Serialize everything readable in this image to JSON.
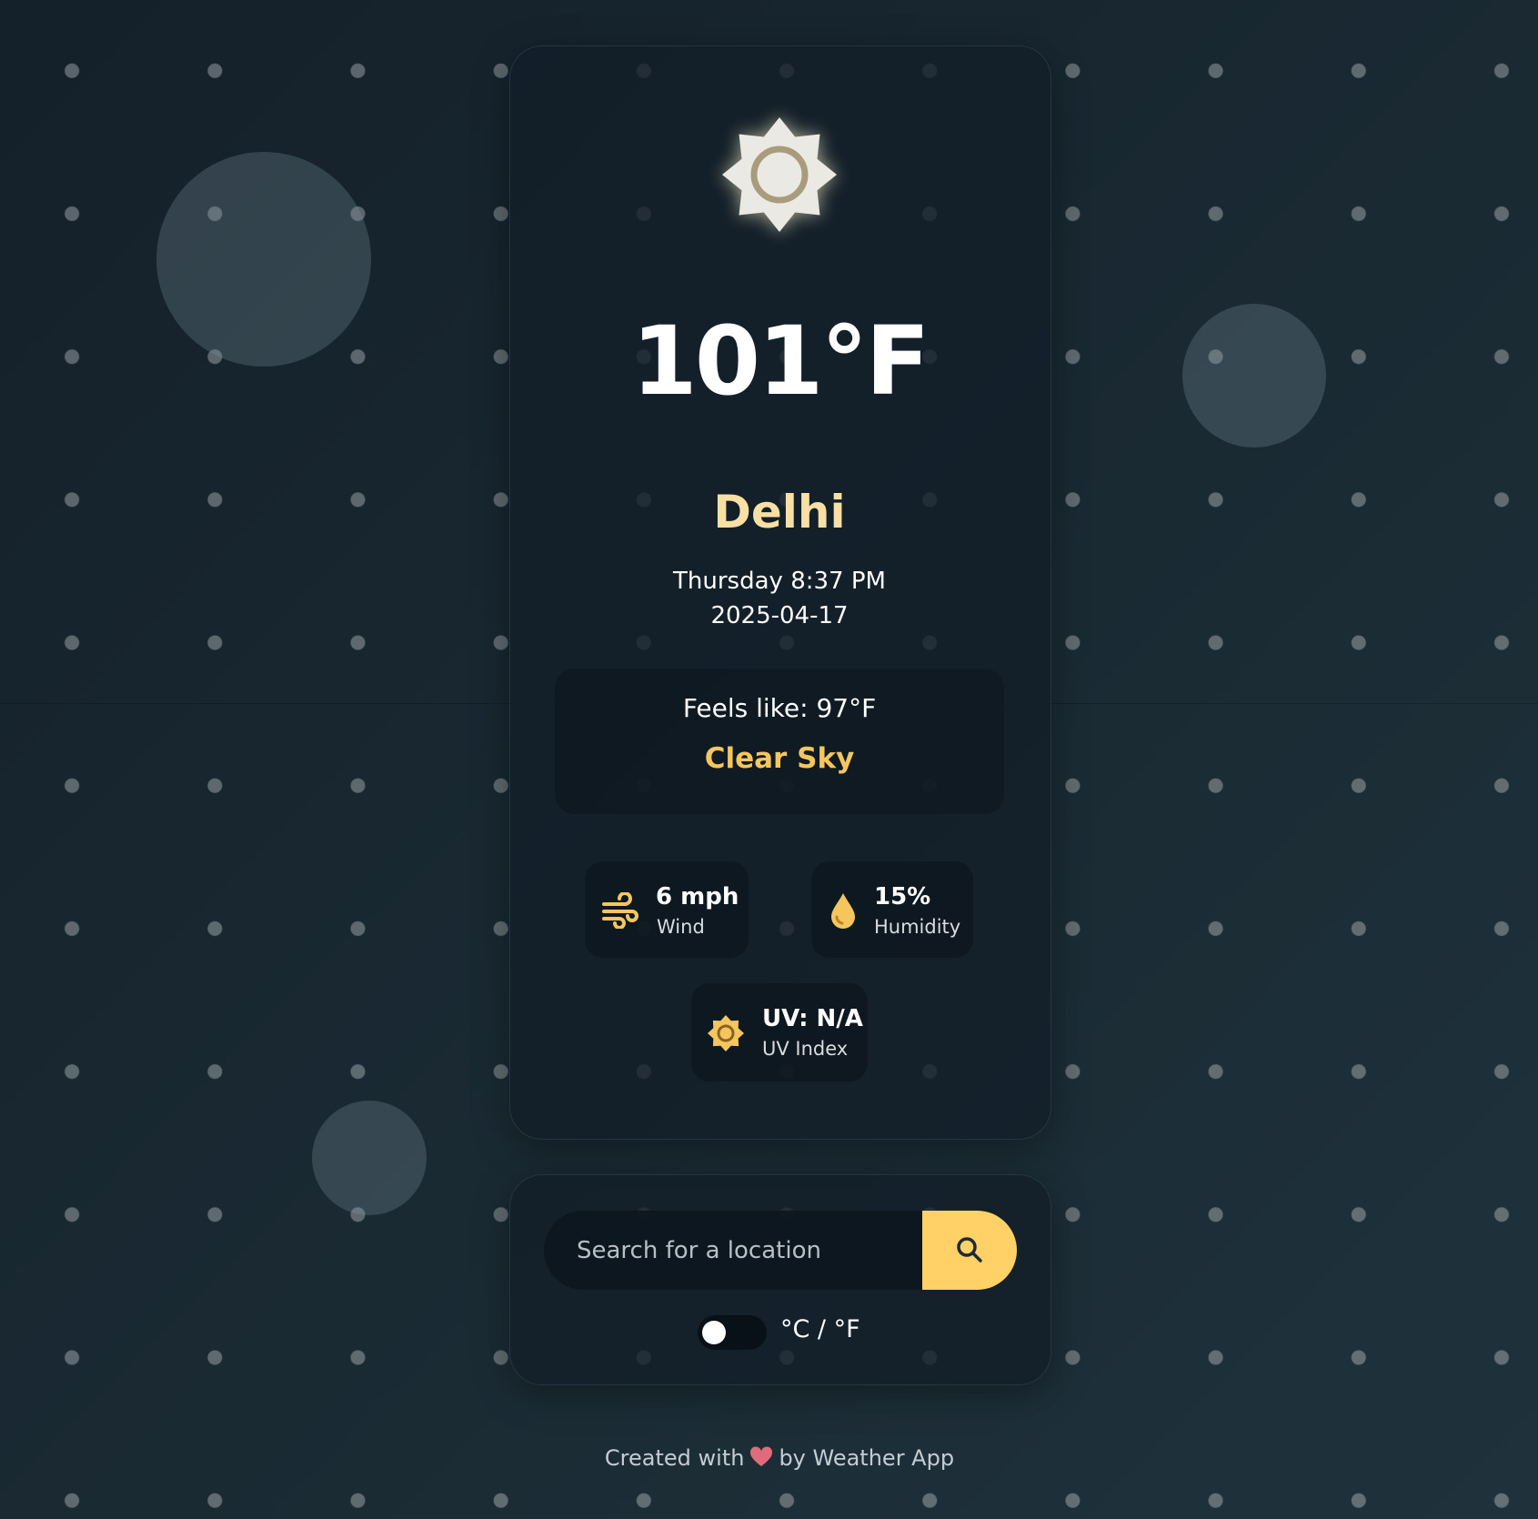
{
  "weather": {
    "temperature": "101°F",
    "city": "Delhi",
    "day_time": "Thursday 8:37 PM",
    "date": "2025-04-17",
    "feels_like": "Feels like: 97°F",
    "condition": "Clear Sky",
    "icon": "sun-icon"
  },
  "stats": {
    "wind": {
      "value": "6 mph",
      "label": "Wind",
      "icon": "wind-icon"
    },
    "humidity": {
      "value": "15%",
      "label": "Humidity",
      "icon": "water-drop-icon"
    },
    "uv": {
      "value": "UV: N/A",
      "label": "UV Index",
      "icon": "sun-icon"
    }
  },
  "search": {
    "placeholder": "Search for a location",
    "button_icon": "search-icon"
  },
  "units": {
    "label": "°C / °F",
    "selected": "°C"
  },
  "footer": {
    "prefix": "Created with",
    "suffix": "by Weather App",
    "icon": "heart-icon"
  },
  "colors": {
    "accent": "#ffd166",
    "city": "#f8dfa4",
    "condition": "#f6c65e",
    "heart": "#e06b7a"
  }
}
